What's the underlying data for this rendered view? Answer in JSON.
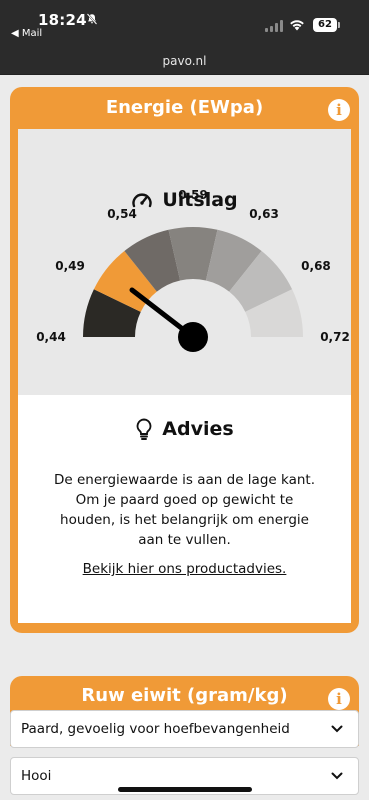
{
  "status": {
    "time": "18:24",
    "back_label": "◀ Mail",
    "battery": "62"
  },
  "browser": {
    "url": "pavo.nl"
  },
  "card": {
    "title": "Energie (EWpa)",
    "info_label": "i",
    "result_title": "Uitslag",
    "gauge": {
      "labels": [
        "0,44",
        "0,49",
        "0,54",
        "0,59",
        "0,63",
        "0,68",
        "0,72"
      ],
      "segment_colors": [
        "#2b2925",
        "#f09a37",
        "#6f6a66",
        "#86837f",
        "#a09e9c",
        "#bdbcbb",
        "#d9d8d7"
      ],
      "highlighted_segment": 1
    },
    "advice_title": "Advies",
    "advice_text": "De energiewaarde is aan de lage kant. Om je paard goed op gewicht te houden, is het belangrijk om energie aan te vullen.",
    "advice_link": "Bekijk hier ons productadvies."
  },
  "card2": {
    "title": "Ruw eiwit (gram/kg)",
    "info_label": "i"
  },
  "selects": [
    {
      "value": "Paard, gevoelig voor hoefbevangenheid"
    },
    {
      "value": "Hooi"
    }
  ],
  "colors": {
    "accent": "#f09a37",
    "dark": "#2b2b2b"
  }
}
